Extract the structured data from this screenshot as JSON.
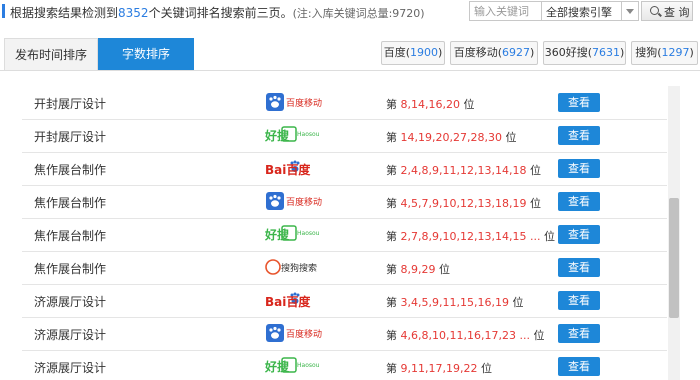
{
  "header": {
    "summary_prefix": "根据搜索结果检测到",
    "keyword_count": "8352",
    "summary_suffix": "个关键词排名搜索前三页。",
    "total_note": "(注:入库关键词总量:9720)",
    "search_placeholder": "输入关键词",
    "engine_selected": "全部搜索引擎",
    "query_label": "查 询"
  },
  "tabs": [
    {
      "label": "发布时间排序",
      "active": false
    },
    {
      "label": "字数排序",
      "active": true
    }
  ],
  "engine_chips": [
    {
      "name": "百度",
      "count": "1900"
    },
    {
      "name": "百度移动",
      "count": "6927"
    },
    {
      "name": "360好搜",
      "count": "7631"
    },
    {
      "name": "搜狗",
      "count": "1297"
    }
  ],
  "table": {
    "rank_prefix": "第",
    "rank_suffix": "位",
    "view_label": "查看",
    "rows": [
      {
        "keyword": "开封展厅设计",
        "engine": "baidu-mobile",
        "engine_label": "百度移动",
        "positions": "8,14,16,20"
      },
      {
        "keyword": "开封展厅设计",
        "engine": "haosou",
        "engine_label": "好搜",
        "engine_sub": "Haosou",
        "positions": "14,19,20,27,28,30"
      },
      {
        "keyword": "焦作展台制作",
        "engine": "baidu",
        "engine_label": "Bai百度",
        "positions": "2,4,8,9,11,12,13,14,18"
      },
      {
        "keyword": "焦作展台制作",
        "engine": "baidu-mobile",
        "engine_label": "百度移动",
        "positions": "4,5,7,9,10,12,13,18,19"
      },
      {
        "keyword": "焦作展台制作",
        "engine": "haosou",
        "engine_label": "好搜",
        "engine_sub": "Haosou",
        "positions": "2,7,8,9,10,12,13,14,15 ..."
      },
      {
        "keyword": "焦作展台制作",
        "engine": "sogou",
        "engine_label": "搜狗搜索",
        "positions": "8,9,29"
      },
      {
        "keyword": "济源展厅设计",
        "engine": "baidu",
        "engine_label": "Bai百度",
        "positions": "3,4,5,9,11,15,16,19"
      },
      {
        "keyword": "济源展厅设计",
        "engine": "baidu-mobile",
        "engine_label": "百度移动",
        "positions": "4,6,8,10,11,16,17,23 ..."
      },
      {
        "keyword": "济源展厅设计",
        "engine": "haosou",
        "engine_label": "好搜",
        "engine_sub": "Haosou",
        "positions": "9,11,17,19,22"
      }
    ]
  },
  "colors": {
    "accent": "#1e87d8",
    "rank_red": "#e53935",
    "count_blue": "#2b7de1"
  }
}
